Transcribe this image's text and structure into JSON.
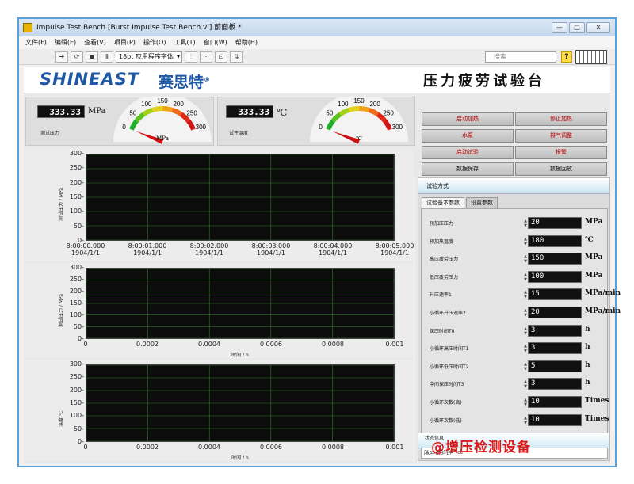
{
  "window": {
    "title": "Impulse Test Bench [Burst Impulse Test Bench.vi] 前面板 *",
    "buttons": [
      "—",
      "□",
      "✕"
    ]
  },
  "menu": [
    "文件(F)",
    "编辑(E)",
    "查看(V)",
    "项目(P)",
    "操作(O)",
    "工具(T)",
    "窗口(W)",
    "帮助(H)"
  ],
  "toolbar": {
    "font": "18pt 应用程序字体",
    "search_placeholder": "搜索",
    "help": "?"
  },
  "header": {
    "logo": "SHINEAST",
    "logo_cn": "赛思特",
    "logo_mark": "®",
    "title": "压力疲劳试验台"
  },
  "gauges": [
    {
      "value": "333.33",
      "unit": "MPa",
      "caption": "测试压力",
      "dial_unit": "MPa",
      "ticks": [
        "0",
        "50",
        "100",
        "150",
        "200",
        "250",
        "300"
      ],
      "level": 0.0
    },
    {
      "value": "333.33",
      "unit": "℃",
      "caption": "试件温度",
      "dial_unit": "℃",
      "ticks": [
        "0",
        "50",
        "100",
        "150",
        "200",
        "250",
        "300"
      ],
      "level": 0.0
    }
  ],
  "buttons": [
    {
      "label": "启动加热",
      "style": "red"
    },
    {
      "label": "停止加热",
      "style": "red"
    },
    {
      "label": "水泵",
      "style": "red"
    },
    {
      "label": "排气调整",
      "style": "red"
    },
    {
      "label": "启动试验",
      "style": "red"
    },
    {
      "label": "报警",
      "style": "red"
    },
    {
      "label": "数据保存",
      "style": "gray"
    },
    {
      "label": "数据回放",
      "style": "gray"
    }
  ],
  "charts": [
    {
      "yticks": [
        "300",
        "250",
        "200",
        "150",
        "100",
        "50",
        "0"
      ],
      "xticks": [
        [
          "8:00:00.000",
          "1904/1/1"
        ],
        [
          "8:00:01.000",
          "1904/1/1"
        ],
        [
          "8:00:02.000",
          "1904/1/1"
        ],
        [
          "8:00:03.000",
          "1904/1/1"
        ],
        [
          "8:00:04.000",
          "1904/1/1"
        ],
        [
          "8:00:05.000",
          "1904/1/1"
        ]
      ],
      "ylabel": "测试压力 / MPa",
      "xlabel": ""
    },
    {
      "yticks": [
        "300",
        "250",
        "200",
        "150",
        "100",
        "50",
        "0"
      ],
      "xticks": [
        [
          "0"
        ],
        [
          "0.0002"
        ],
        [
          "0.0004"
        ],
        [
          "0.0006"
        ],
        [
          "0.0008"
        ],
        [
          "0.001"
        ]
      ],
      "ylabel": "测试压力 / MPa",
      "xlabel": "时间 / h"
    },
    {
      "yticks": [
        "300",
        "250",
        "200",
        "150",
        "100",
        "50",
        "0"
      ],
      "xticks": [
        [
          "0"
        ],
        [
          "0.0002"
        ],
        [
          "0.0004"
        ],
        [
          "0.0006"
        ],
        [
          "0.0008"
        ],
        [
          "0.001"
        ]
      ],
      "ylabel": "温度 ℃",
      "xlabel": "时间 / h"
    }
  ],
  "panel": {
    "method_label": "试验方式",
    "tabs": [
      "试验基本参数",
      "设置参数"
    ],
    "params": [
      {
        "label": "预加压压力",
        "value": "20",
        "unit": "MPa"
      },
      {
        "label": "预加热温度",
        "value": "180",
        "unit": "℃"
      },
      {
        "label": "高压疲劳压力",
        "value": "150",
        "unit": "MPa"
      },
      {
        "label": "低压疲劳压力",
        "value": "100",
        "unit": "MPa"
      },
      {
        "label": "升压速率1",
        "value": "15",
        "unit": "MPa/min"
      },
      {
        "label": "小循环升压速率2",
        "value": "20",
        "unit": "MPa/min"
      },
      {
        "label": "保压时间T0",
        "value": "3",
        "unit": "h"
      },
      {
        "label": "小循环高压时间T1",
        "value": "3",
        "unit": "h"
      },
      {
        "label": "小循环低压时间T2",
        "value": "5",
        "unit": "h"
      },
      {
        "label": "中间保压时间T3",
        "value": "3",
        "unit": "h"
      },
      {
        "label": "小循环次数(高)",
        "value": "10",
        "unit": "Times"
      },
      {
        "label": "小循环次数(低)",
        "value": "10",
        "unit": "Times"
      }
    ],
    "status_label": "状态信息",
    "status_value": "脉冲试验进行中"
  },
  "watermark": "@增压检测设备",
  "colors": {
    "accent": "#1d57a5",
    "alarm": "#b00000",
    "plot_bg": "#0c0c0c",
    "plot_grid": "#2e7a2e"
  }
}
